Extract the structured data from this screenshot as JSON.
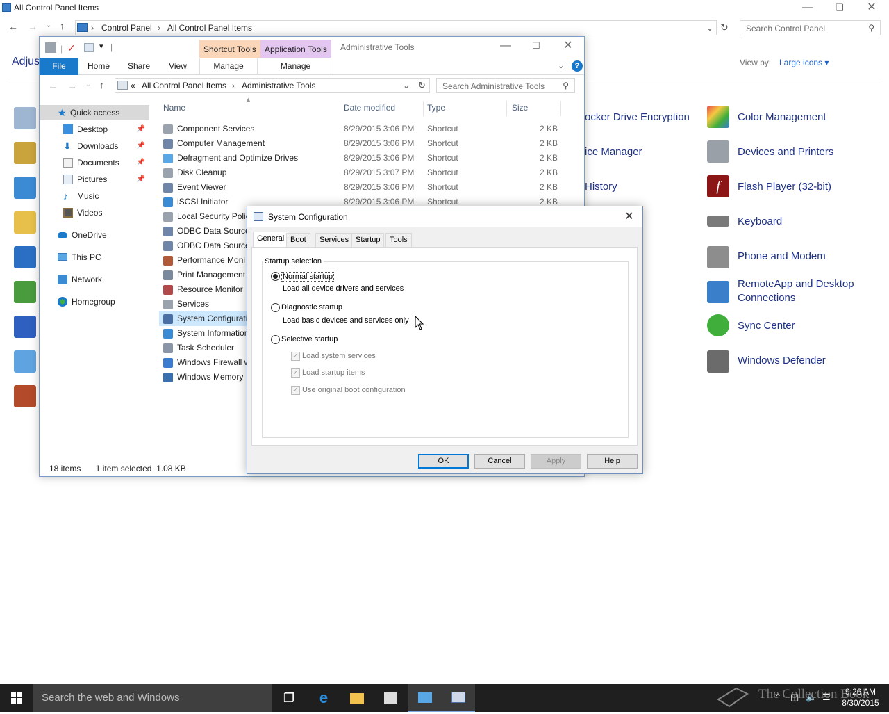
{
  "control_panel": {
    "title": "All Control Panel Items",
    "breadcrumb": [
      "Control Panel",
      "All Control Panel Items"
    ],
    "search_placeholder": "Search Control Panel",
    "adjust_text": "Adjus",
    "view_by_label": "View by:",
    "view_by_value": "Large icons",
    "items_middle": [
      "ocker Drive Encryption",
      "ice Manager",
      "History"
    ],
    "items_right": [
      {
        "label": "Color Management",
        "icon": "color-management-icon",
        "color": "#3b7cd1"
      },
      {
        "label": "Devices and Printers",
        "icon": "printer-icon",
        "color": "#8a8f99"
      },
      {
        "label": "Flash Player (32-bit)",
        "icon": "flash-icon",
        "color": "#b21b1b"
      },
      {
        "label": "Keyboard",
        "icon": "keyboard-icon",
        "color": "#6f6f6f"
      },
      {
        "label": "Phone and Modem",
        "icon": "phone-icon",
        "color": "#7a7a7a"
      },
      {
        "label": "RemoteApp and Desktop",
        "label2": "Connections",
        "icon": "remoteapp-icon",
        "color": "#3a7fc9"
      },
      {
        "label": "Sync Center",
        "icon": "sync-icon",
        "color": "#3fae3a"
      },
      {
        "label": "Windows Defender",
        "icon": "defender-icon",
        "color": "#6b6b6b"
      }
    ]
  },
  "explorer": {
    "window_title": "Administrative Tools",
    "context_tabs": [
      "Shortcut Tools",
      "Application Tools"
    ],
    "ribbon_tabs": [
      "File",
      "Home",
      "Share",
      "View",
      "Manage",
      "Manage"
    ],
    "breadcrumb": [
      "All Control Panel Items",
      "Administrative Tools"
    ],
    "breadcrumb_prefix": "«",
    "search_placeholder": "Search Administrative Tools",
    "sidebar": [
      {
        "label": "Quick access",
        "icon": "star-icon",
        "pinned": false
      },
      {
        "label": "Desktop",
        "icon": "desktop-icon",
        "pinned": true
      },
      {
        "label": "Downloads",
        "icon": "downloads-icon",
        "pinned": true
      },
      {
        "label": "Documents",
        "icon": "documents-icon",
        "pinned": true
      },
      {
        "label": "Pictures",
        "icon": "pictures-icon",
        "pinned": true
      },
      {
        "label": "Music",
        "icon": "music-icon",
        "pinned": false
      },
      {
        "label": "Videos",
        "icon": "videos-icon",
        "pinned": false
      },
      {
        "label": "OneDrive",
        "icon": "onedrive-icon",
        "pinned": false
      },
      {
        "label": "This PC",
        "icon": "pc-icon",
        "pinned": false
      },
      {
        "label": "Network",
        "icon": "network-icon",
        "pinned": false
      },
      {
        "label": "Homegroup",
        "icon": "homegroup-icon",
        "pinned": false
      }
    ],
    "columns": [
      "Name",
      "Date modified",
      "Type",
      "Size"
    ],
    "files": [
      {
        "name": "Component Services",
        "date": "8/29/2015 3:06 PM",
        "type": "Shortcut",
        "size": "2 KB"
      },
      {
        "name": "Computer Management",
        "date": "8/29/2015 3:06 PM",
        "type": "Shortcut",
        "size": "2 KB"
      },
      {
        "name": "Defragment and Optimize Drives",
        "date": "8/29/2015 3:06 PM",
        "type": "Shortcut",
        "size": "2 KB"
      },
      {
        "name": "Disk Cleanup",
        "date": "8/29/2015 3:07 PM",
        "type": "Shortcut",
        "size": "2 KB"
      },
      {
        "name": "Event Viewer",
        "date": "8/29/2015 3:06 PM",
        "type": "Shortcut",
        "size": "2 KB"
      },
      {
        "name": "iSCSI Initiator",
        "date": "8/29/2015 3:06 PM",
        "type": "Shortcut",
        "size": "2 KB"
      },
      {
        "name": "Local Security Polic",
        "date": "",
        "type": "",
        "size": ""
      },
      {
        "name": "ODBC Data Sources",
        "date": "",
        "type": "",
        "size": ""
      },
      {
        "name": "ODBC Data Sources",
        "date": "",
        "type": "",
        "size": ""
      },
      {
        "name": "Performance Moni",
        "date": "",
        "type": "",
        "size": ""
      },
      {
        "name": "Print Management",
        "date": "",
        "type": "",
        "size": ""
      },
      {
        "name": "Resource Monitor",
        "date": "",
        "type": "",
        "size": ""
      },
      {
        "name": "Services",
        "date": "",
        "type": "",
        "size": ""
      },
      {
        "name": "System Configurati",
        "date": "",
        "type": "",
        "size": "",
        "selected": true
      },
      {
        "name": "System Information",
        "date": "",
        "type": "",
        "size": ""
      },
      {
        "name": "Task Scheduler",
        "date": "",
        "type": "",
        "size": ""
      },
      {
        "name": "Windows Firewall w",
        "date": "",
        "type": "",
        "size": ""
      },
      {
        "name": "Windows Memory",
        "date": "",
        "type": "",
        "size": ""
      }
    ],
    "status": {
      "count": "18 items",
      "selection": "1 item selected  1.08 KB"
    }
  },
  "msconfig": {
    "title": "System Configuration",
    "tabs": [
      "General",
      "Boot",
      "Services",
      "Startup",
      "Tools"
    ],
    "active_tab": "General",
    "group_label": "Startup selection",
    "options": [
      {
        "label": "Normal startup",
        "desc": "Load all device drivers and services",
        "selected": true
      },
      {
        "label": "Diagnostic startup",
        "desc": "Load basic devices and services only",
        "selected": false
      },
      {
        "label": "Selective startup",
        "desc": "",
        "selected": false
      }
    ],
    "selective_checks": [
      {
        "label": "Load system services",
        "checked": true
      },
      {
        "label": "Load startup items",
        "checked": true
      },
      {
        "label": "Use original boot configuration",
        "checked": true
      }
    ],
    "buttons": {
      "ok": "OK",
      "cancel": "Cancel",
      "apply": "Apply",
      "help": "Help"
    }
  },
  "taskbar": {
    "search_placeholder": "Search the web and Windows",
    "time": "9:26 AM",
    "date": "8/30/2015",
    "watermark": "The Collection Book"
  }
}
